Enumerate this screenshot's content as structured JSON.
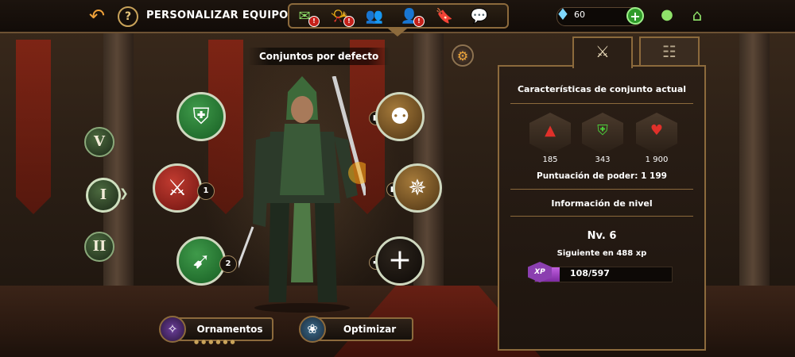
{
  "header": {
    "title": "PERSONALIZAR EQUIPO",
    "back_icon": "back-arrow-icon",
    "help_label": "?",
    "nav_icons": [
      {
        "name": "mail-icon",
        "glyph": "✉",
        "badge": "!"
      },
      {
        "name": "horn-icon",
        "glyph": "📯",
        "badge": "!"
      },
      {
        "name": "guild-icon",
        "glyph": "👥",
        "badge": ""
      },
      {
        "name": "hero-icon",
        "glyph": "👤",
        "badge": "!"
      },
      {
        "name": "bookmark-icon",
        "glyph": "🔖",
        "badge": ""
      },
      {
        "name": "chat-icon",
        "glyph": "💬",
        "badge": ""
      }
    ],
    "gems": "60",
    "colors": {
      "accent_green": "#2f9a2a",
      "frame_gold": "#8c6a3c",
      "badge_red": "#c4201a"
    }
  },
  "sets": {
    "label": "Conjuntos por defecto",
    "tabs": [
      "V",
      "I",
      "II"
    ],
    "selected": "I"
  },
  "slots": {
    "armor_icon": "armor-icon",
    "melee_count": "1",
    "ranged_count": "2",
    "add_label": "+"
  },
  "bottom": {
    "ornaments": "Ornamentos",
    "optimize": "Optimizar"
  },
  "panel": {
    "current_set_title": "Características de conjunto actual",
    "attack": "185",
    "defense": "343",
    "health": "1 900",
    "power_label": "Puntuación de poder:",
    "power_value": "1 199",
    "level_info_title": "Información de nivel",
    "level": "Nv. 6",
    "next_label": "Siguiente en 488 xp",
    "xp_badge": "XP",
    "xp_text": "108/597",
    "xp_current": 108,
    "xp_max": 597
  }
}
